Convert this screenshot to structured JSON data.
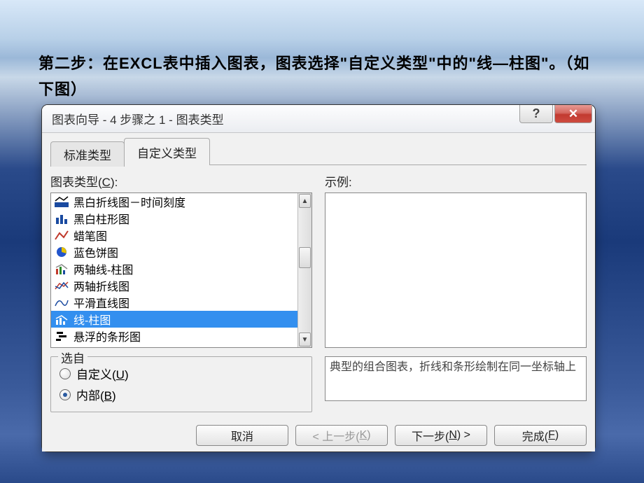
{
  "slide": {
    "heading": "第二步：在EXCL表中插入图表，图表选择\"自定义类型\"中的\"线—柱图\"。（如下图）"
  },
  "dialog": {
    "title": "图表向导 - 4 步骤之 1 - 图表类型",
    "help_symbol": "?",
    "close_symbol": "✕",
    "tabs": {
      "standard": "标准类型",
      "custom": "自定义类型"
    },
    "chart_type_label_prefix": "图表类型(",
    "chart_type_label_key": "C",
    "chart_type_label_suffix": "):",
    "sample_label": "示例:",
    "list": {
      "items": [
        {
          "icon": "bw-line",
          "label": "黑白折线图－时间刻度"
        },
        {
          "icon": "bw-bar",
          "label": "黑白柱形图"
        },
        {
          "icon": "crayon",
          "label": "蜡笔图"
        },
        {
          "icon": "pie-blue",
          "label": "蓝色饼图"
        },
        {
          "icon": "dual-line-bar",
          "label": "两轴线-柱图"
        },
        {
          "icon": "dual-line",
          "label": "两轴折线图"
        },
        {
          "icon": "smooth-line",
          "label": "平滑直线图"
        },
        {
          "icon": "line-bar",
          "label": "线-柱图"
        },
        {
          "icon": "float-bar",
          "label": "悬浮的条形图"
        }
      ],
      "selected_index": 7
    },
    "from_group": {
      "legend": "选自",
      "options": {
        "custom_prefix": "自定义(",
        "custom_key": "U",
        "custom_suffix": ")",
        "builtin_prefix": "内部(",
        "builtin_key": "B",
        "builtin_suffix": ")"
      },
      "selected": "builtin"
    },
    "description": "典型的组合图表，折线和条形绘制在同一坐标轴上",
    "buttons": {
      "cancel": "取消",
      "back_prefix": "< 上一步(",
      "back_key": "K",
      "back_suffix": ")",
      "next_prefix": "下一步(",
      "next_key": "N",
      "next_suffix": ") >",
      "finish_prefix": "完成(",
      "finish_key": "F",
      "finish_suffix": ")"
    }
  }
}
